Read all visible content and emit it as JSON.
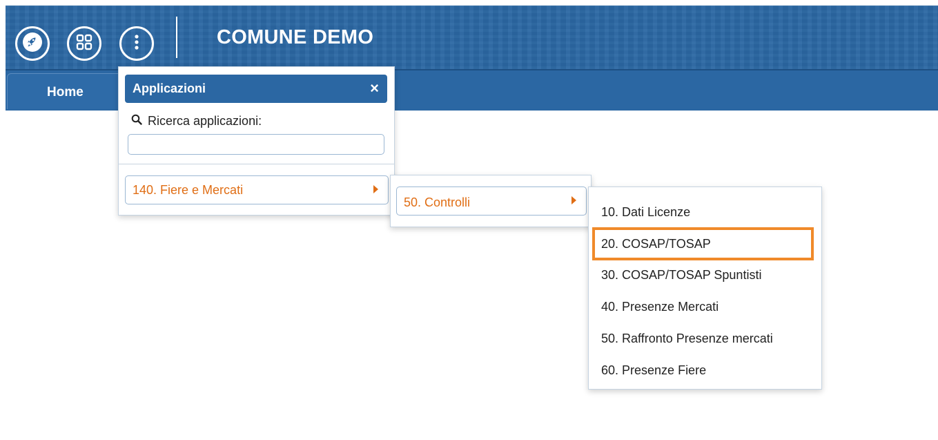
{
  "header": {
    "title": "COMUNE DEMO",
    "buttons": [
      {
        "icon": "rocket-icon"
      },
      {
        "icon": "grid-icon"
      },
      {
        "icon": "more-vertical-icon"
      }
    ]
  },
  "tabs": [
    {
      "label": "Home"
    }
  ],
  "apps_panel": {
    "title": "Applicazioni",
    "close_symbol": "×",
    "search_label": "Ricerca applicazioni:",
    "search_value": "",
    "items": [
      {
        "label": "140. Fiere e Mercati"
      }
    ]
  },
  "submenu_1": {
    "items": [
      {
        "label": "50. Controlli"
      }
    ]
  },
  "submenu_2": {
    "items": [
      {
        "label": "10. Dati Licenze"
      },
      {
        "label": "20. COSAP/TOSAP"
      },
      {
        "label": "30. COSAP/TOSAP Spuntisti"
      },
      {
        "label": "40. Presenze Mercati"
      },
      {
        "label": "50. Raffronto Presenze mercati"
      },
      {
        "label": "60. Presenze Fiere"
      }
    ],
    "highlighted_index": 1
  },
  "colors": {
    "primary": "#2b67a3",
    "accent": "#e06e15",
    "highlight": "#f08a2a"
  }
}
